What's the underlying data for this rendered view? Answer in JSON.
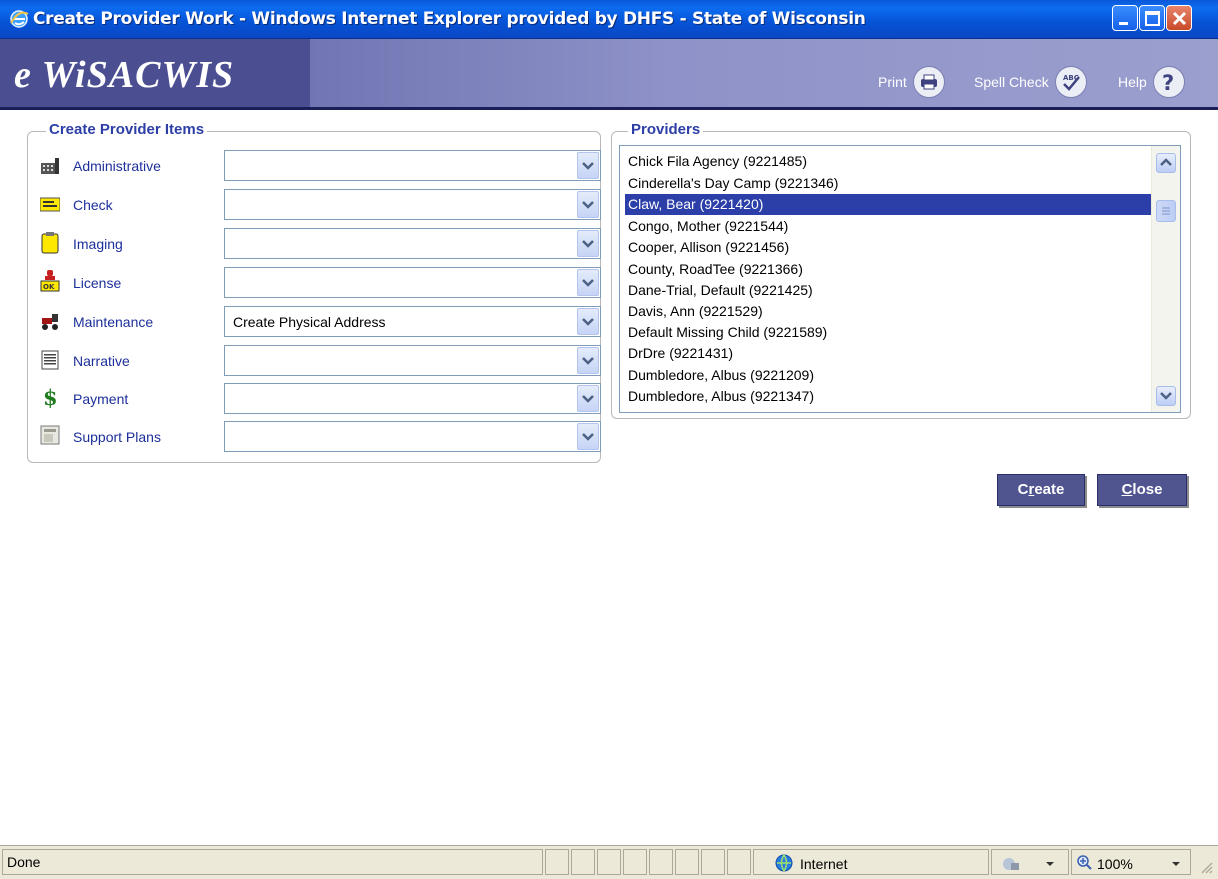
{
  "window": {
    "title": "Create Provider Work - Windows Internet Explorer provided by DHFS - State of Wisconsin"
  },
  "header": {
    "brand": "e WiSACWIS",
    "tools": [
      {
        "label": "Print",
        "icon": "printer-icon"
      },
      {
        "label": "Spell Check",
        "icon": "spellcheck-icon"
      },
      {
        "label": "Help",
        "icon": "help-icon"
      }
    ]
  },
  "create_items": {
    "legend": "Create Provider Items",
    "rows": [
      {
        "label": "Administrative",
        "icon": "building-icon",
        "value": ""
      },
      {
        "label": "Check",
        "icon": "check-icon",
        "value": ""
      },
      {
        "label": "Imaging",
        "icon": "clipboard-icon",
        "value": ""
      },
      {
        "label": "License",
        "icon": "license-stamp-icon",
        "value": ""
      },
      {
        "label": "Maintenance",
        "icon": "tractor-icon",
        "value": "Create Physical Address"
      },
      {
        "label": "Narrative",
        "icon": "document-icon",
        "value": ""
      },
      {
        "label": "Payment",
        "icon": "dollar-icon",
        "value": ""
      },
      {
        "label": "Support Plans",
        "icon": "support-plan-icon",
        "value": ""
      }
    ]
  },
  "providers": {
    "legend": "Providers",
    "items": [
      "Chick Fila Agency (9221485)",
      "Cinderella's Day Camp (9221346)",
      "Claw, Bear (9221420)",
      "Congo, Mother (9221544)",
      "Cooper, Allison (9221456)",
      "County, RoadTee (9221366)",
      "Dane-Trial, Default (9221425)",
      "Davis, Ann (9221529)",
      "Default Missing Child (9221589)",
      "DrDre (9221431)",
      "Dumbledore, Albus (9221209)",
      "Dumbledore, Albus (9221347)"
    ],
    "selected_index": 2
  },
  "buttons": {
    "create": {
      "pre": "C",
      "ul": "r",
      "post": "eate"
    },
    "close": {
      "pre": "",
      "ul": "C",
      "post": "lose"
    }
  },
  "status": {
    "text": "Done",
    "zone": "Internet",
    "zoom": "100%"
  },
  "colors": {
    "accent": "#2d3fa6",
    "selected": "#2c3fa8",
    "button": "#505590"
  }
}
